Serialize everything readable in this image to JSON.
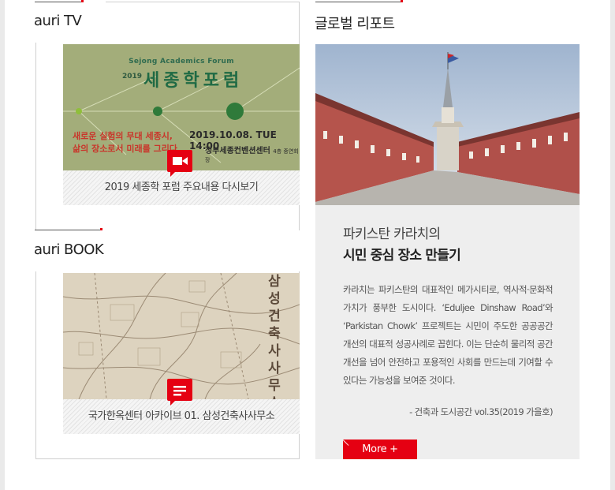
{
  "tv": {
    "title": "auri TV",
    "poster": {
      "english_title": "Sejong Academics Forum",
      "year": "2019",
      "korean_title": "세종학포럼",
      "tagline_line1": "새로운 실험의 무대 세종시,",
      "tagline_line2": "삶의 장소로서 미래를 그리다",
      "date": "2019.10.08. TUE 14:00",
      "venue": "정부세종컨벤션센터",
      "venue_detail": "4층 중연회장"
    },
    "caption": "2019 세종학 포럼 주요내용 다시보기",
    "badge_icon": "video-camera-icon"
  },
  "book": {
    "title": "auri BOOK",
    "vertical_title": "삼성건축사사무소",
    "caption": "국가한옥센터 아카이브 01. 삼성건축사사무소",
    "badge_icon": "document-icon"
  },
  "report": {
    "title": "글로벌 리포트",
    "subtitle": "파키스탄 카라치의",
    "headline": "시민 중심 장소 만들기",
    "body": "카라치는 파키스탄의 대표적인 메가시티로, 역사적·문화적 가치가 풍부한 도시이다. ‘Eduljee Dinshaw Road’와 ‘Parkistan Chowk’ 프로젝트는 시민이 주도한 공공공간 개선의 대표적 성공사례로 꼽힌다. 이는 단순히 물리적 공간 개선을 넘어 안전하고 포용적인 사회를 만드는데 기여할 수 있다는 가능성을 보여준 것이다.",
    "source": "- 건축과 도시공간 vol.35(2019 가을호)",
    "more_label": "More  +"
  },
  "colors": {
    "accent": "#e50012",
    "poster_green": "#a3ad7a",
    "panel_bg": "#eeeeee"
  }
}
